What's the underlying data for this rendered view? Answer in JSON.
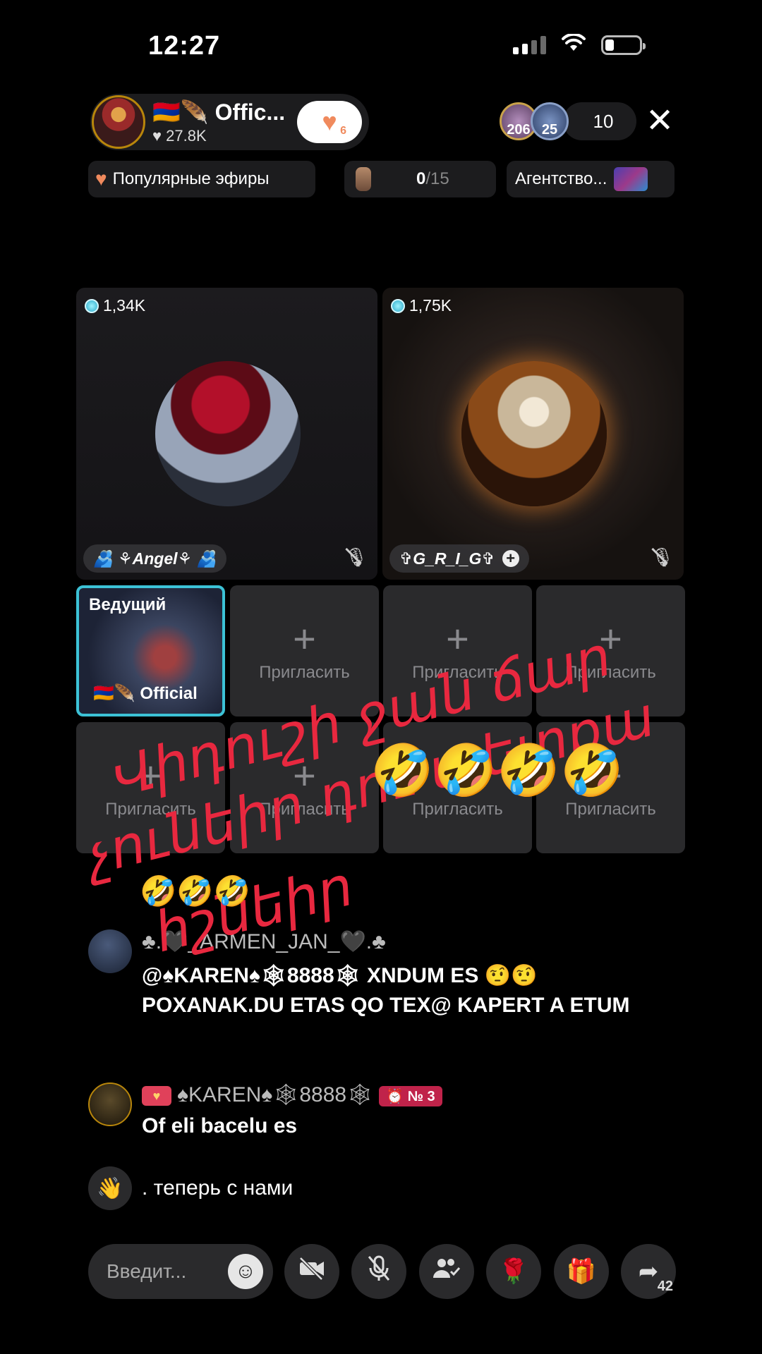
{
  "status": {
    "time": "12:27"
  },
  "host": {
    "name": "🇦🇲🪶 Offic...",
    "likes": "♥ 27.8K",
    "follow_count": "6"
  },
  "viewers": {
    "avatar1_label": "206",
    "avatar2_label": "25",
    "count": "10"
  },
  "chips": {
    "popular": "Популярные эфиры",
    "gift_progress_current": "0",
    "gift_progress_total": "/15",
    "agency": "Агентство..."
  },
  "guests": [
    {
      "coins": "1,34K",
      "name": "🫂 ⚘Angel⚘ 🫂"
    },
    {
      "coins": "1,75K",
      "name": "✞G_R_I_G✞"
    }
  ],
  "host_slot": {
    "label": "Ведущий",
    "sub": "🇦🇲🪶 Official"
  },
  "slots": {
    "plus": "+",
    "invite_label": "Пригласить"
  },
  "overlay": {
    "line1": "Վիդուշի ջան ճար",
    "line2": "չունեիր դու պետքա",
    "line3": "հշնեիր",
    "emojis": "🤣🤣🤣🤣",
    "emojis_small": "🤣🤣🤣"
  },
  "chat": [
    {
      "user": "♣.🖤_ARMEN_JAN_🖤.♣",
      "message": "@♠KAREN♠🕸8888🕸 XNDUM ES 🤨🤨 POXANAK.DU ETAS QO TEX@ KAPERT A ETUM"
    },
    {
      "user": "♠KAREN♠🕸8888🕸",
      "rank": "⏰ № 3",
      "message": "Of eli bacelu es"
    },
    {
      "message": ". теперь с нами"
    }
  ],
  "bottom": {
    "input_placeholder": "Введит...",
    "share_count": "42"
  },
  "colors": {
    "accent": "#3cc2d6",
    "overlay_red": "#e8283f",
    "like": "#f08a5d"
  }
}
